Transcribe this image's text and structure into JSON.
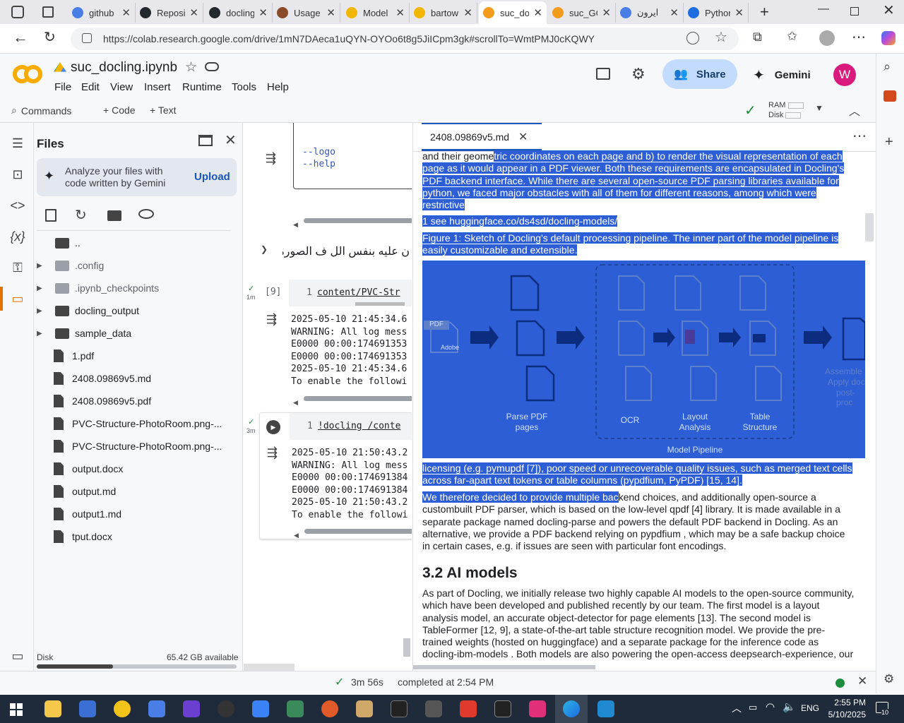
{
  "browser": {
    "tabs": [
      {
        "title": "github",
        "color": "#4a7ee6"
      },
      {
        "title": "Reposi",
        "color": "#24292f"
      },
      {
        "title": "docling",
        "color": "#24292f"
      },
      {
        "title": "Usage",
        "color": "#8a4b2a"
      },
      {
        "title": "Model",
        "color": "#f2b705"
      },
      {
        "title": "bartow",
        "color": "#f2b705"
      },
      {
        "title": "suc_do",
        "color": "#f29b1d"
      },
      {
        "title": "suc_GC",
        "color": "#f29b1d"
      },
      {
        "title": "ايرون",
        "color": "#4a7ee6"
      },
      {
        "title": "Pythor",
        "color": "#1d6de0"
      }
    ],
    "url": "https://colab.research.google.com/drive/1mN7DAeca1uQYN-OYOo6t8g5JiICpm3gk#scrollTo=WmtPMJ0cKQWY"
  },
  "colab": {
    "notebook_title": "suc_docling.ipynb",
    "menu": [
      "File",
      "Edit",
      "View",
      "Insert",
      "Runtime",
      "Tools",
      "Help"
    ],
    "share_label": "Share",
    "gemini_label": "Gemini",
    "avatar_letter": "W",
    "commands_label": "Commands",
    "code_label": "Code",
    "text_label": "Text",
    "ram_label": "RAM",
    "disk_label": "Disk"
  },
  "files_panel": {
    "title": "Files",
    "gemini_prompt": "Analyze your files with code written by Gemini",
    "upload_label": "Upload",
    "items": [
      {
        "name": "..",
        "kind": "folder",
        "expandable": false
      },
      {
        "name": ".config",
        "kind": "folder-light",
        "expandable": true
      },
      {
        "name": ".ipynb_checkpoints",
        "kind": "folder-light",
        "expandable": true
      },
      {
        "name": "docling_output",
        "kind": "folder",
        "expandable": true
      },
      {
        "name": "sample_data",
        "kind": "folder",
        "expandable": true
      },
      {
        "name": "1.pdf",
        "kind": "file",
        "expandable": false
      },
      {
        "name": "2408.09869v5.md",
        "kind": "file",
        "expandable": false
      },
      {
        "name": "2408.09869v5.pdf",
        "kind": "file",
        "expandable": false
      },
      {
        "name": "PVC-Structure-PhotoRoom.png-...",
        "kind": "file",
        "expandable": false
      },
      {
        "name": "PVC-Structure-PhotoRoom.png-...",
        "kind": "file",
        "expandable": false
      },
      {
        "name": "output.docx",
        "kind": "file",
        "expandable": false
      },
      {
        "name": "output.md",
        "kind": "file",
        "expandable": false
      },
      {
        "name": "output1.md",
        "kind": "file",
        "expandable": false
      },
      {
        "name": "tput.docx",
        "kind": "file",
        "expandable": false
      }
    ],
    "disk_label": "Disk",
    "disk_available": "65.42 GB available",
    "disk_used_fraction": 0.38
  },
  "notebook": {
    "help_lines": [
      "--logo",
      "--help"
    ],
    "section_heading": "ن عليه بنفس الل ف الصوره",
    "cell1": {
      "exec_count": "[9]",
      "time": "1m",
      "line_no": "1",
      "source": "content/PVC-Str",
      "output": [
        "2025-05-10 21:45:34.6",
        "WARNING: All log mess",
        "E0000 00:00:174691353",
        "E0000 00:00:174691353",
        "2025-05-10 21:45:34.6",
        "To enable the followi"
      ]
    },
    "cell2": {
      "time": "3m",
      "line_no": "1",
      "source": "!docling /conte",
      "output": [
        "2025-05-10 21:50:43.2",
        "WARNING: All log mess",
        "E0000 00:00:174691384",
        "E0000 00:00:174691384",
        "2025-05-10 21:50:43.2",
        "To enable the followi"
      ]
    }
  },
  "viewer": {
    "tab_name": "2408.09869v5.md",
    "p1": "and their geometric coordinates on each page and b) to render the visual representation of each page as it would appear in a PDF viewer. Both these requirements are encapsulated in Docling's PDF backend interface. While there are several open-source PDF parsing libraries available for python, we faced major obstacles with all of them for different reasons, among which were restrictive",
    "footnote": "1 see huggingface.co/ds4sd/docling-models/",
    "caption": "Figure 1: Sketch of Docling's default processing pipeline. The inner part of the model pipeline is easily customizable and extensible.",
    "figure": {
      "pdf_label": "PDF",
      "adobe_label": "Adobe",
      "parse_label": "Parse PDF pages",
      "ocr_label": "OCR",
      "layout_label": "Layout Analysis",
      "table_label": "Table Structure",
      "model_pipeline_label": "Model Pipeline",
      "assemble_label": "Assemble",
      "apply_label": "Apply doc",
      "post_label": "post-proc"
    },
    "p2": "licensing (e.g. pymupdf [7]), poor speed or unrecoverable quality issues, such as merged text cells across far-apart text tokens or table columns (pypdfium, PyPDF) [15, 14].",
    "p3_hl": "We therefore decided to provide multiple bac",
    "p3_rest": "kend choices, and additionally open-source a custombuilt PDF parser, which is based on the low-level qpdf [4] library. It is made available in a separate package named docling-parse and powers the default PDF backend in Docling. As an alternative, we provide a PDF backend relying on pypdfium , which may be a safe backup choice in certain cases, e.g. if issues are seen with particular font encodings.",
    "heading": "3.2 AI models",
    "p4": "As part of Docling, we initially release two highly capable AI models to the open-source community, which have been developed and published recently by our team. The first model is a layout analysis model, an accurate object-detector for page elements [13]. The second model is TableFormer [12, 9], a state-of-the-art table structure recognition model. We provide the pre-trained weights (hosted on huggingface) and a separate package for the inference code as docling-ibm-models . Both models are also powering the open-access deepsearch-experience, our cloud-native service for"
  },
  "status_bar": {
    "elapsed": "3m 56s",
    "completed": "completed at 2:54 PM"
  },
  "taskbar": {
    "lang": "ENG",
    "time": "2:55 PM",
    "date": "5/10/2025",
    "notif": "10"
  },
  "colors": {
    "highlight": "#2d5ed6",
    "share_bg": "#c2dbff",
    "avatar_bg": "#d81b7c",
    "taskbar_bg": "#1f2b3a"
  }
}
